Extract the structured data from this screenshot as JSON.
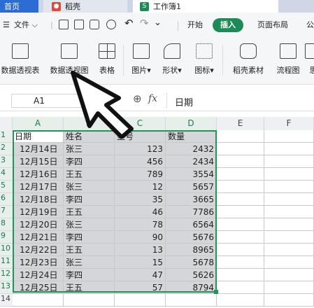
{
  "tabs": {
    "home": "首页",
    "docer": "稻壳",
    "book": "工作簿1"
  },
  "menu": {
    "file": "文件",
    "start": "开始",
    "insert": "插入",
    "layout": "页面布局",
    "formula": "公"
  },
  "ribbon": {
    "pivot_table": "数据透视表",
    "pivot_chart": "数据透视图",
    "table": "表格",
    "picture": "图片",
    "shape": "形状",
    "icon": "图标",
    "docer_material": "稻壳素材",
    "flowchart": "流程图",
    "partial": "思"
  },
  "formula_bar": {
    "name_box": "A1",
    "fx": "fx",
    "content": "日期"
  },
  "sheet": {
    "columns": [
      "A",
      "B",
      "C",
      "D",
      "E",
      "F"
    ],
    "row_numbers": [
      "1",
      "2",
      "3",
      "4",
      "5",
      "6",
      "7",
      "8",
      "9",
      "10",
      "11",
      "12",
      "13",
      "14"
    ],
    "header": [
      "日期",
      "姓名",
      "型号",
      "数量"
    ],
    "rows": [
      [
        "12月14日",
        "张三",
        "123",
        "2432"
      ],
      [
        "12月15日",
        "李四",
        "456",
        "2434"
      ],
      [
        "12月16日",
        "王五",
        "789",
        "3554"
      ],
      [
        "12月17日",
        "张三",
        "12",
        "5657"
      ],
      [
        "12月18日",
        "李四",
        "35",
        "3665"
      ],
      [
        "12月19日",
        "王五",
        "46",
        "7786"
      ],
      [
        "12月20日",
        "张三",
        "78",
        "6564"
      ],
      [
        "12月21日",
        "李四",
        "90",
        "5676"
      ],
      [
        "12月22日",
        "王五",
        "13",
        "8965"
      ],
      [
        "12月23日",
        "张三",
        "15",
        "5678"
      ],
      [
        "12月24日",
        "李四",
        "47",
        "5626"
      ],
      [
        "12月25日",
        "王五",
        "57",
        "8794"
      ]
    ]
  },
  "colors": {
    "accent_green": "#1e8a58",
    "selection": "#24925c",
    "tab_blue": "#2c6cd5"
  }
}
